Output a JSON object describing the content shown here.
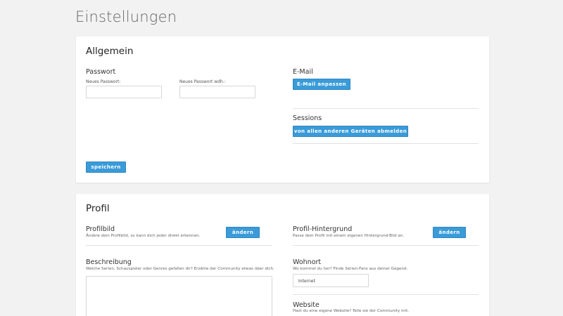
{
  "page": {
    "title": "Einstellungen"
  },
  "general": {
    "title": "Allgemein",
    "password": {
      "heading": "Passwort",
      "new_label": "Neues Passwort:",
      "repeat_label": "Neues Passwort wdh.:",
      "new_value": "",
      "repeat_value": ""
    },
    "email": {
      "heading": "E-Mail",
      "button": "E-Mail anpassen"
    },
    "sessions": {
      "heading": "Sessions",
      "button": "von allen anderen Geräten abmelden"
    },
    "save_button": "speichern"
  },
  "profile": {
    "title": "Profil",
    "picture": {
      "heading": "Profilbild",
      "description": "Ändere dein Profilbild, so kann dich jeder direkt erkennen.",
      "button": "ändern"
    },
    "background": {
      "heading": "Profil-Hintergrund",
      "description": "Passe dein Profil mit einem eigenen Hintergrund-Bild an.",
      "button": "ändern"
    },
    "bio": {
      "heading": "Beschreibung",
      "description": "Welche Serien, Schauspieler oder Genres gefallen dir? Erzähle der Community etwas über dich.",
      "value": ""
    },
    "location": {
      "heading": "Wohnort",
      "description": "Wo kommst du her? Finde Serien-Fans aus deiner Gegend.",
      "value": "Internet"
    },
    "website": {
      "heading": "Website",
      "description": "Hast du eine eigene Website? Teile sie der Community mit."
    }
  },
  "colors": {
    "accent": "#3a9bd9",
    "background": "#f2f2f2",
    "card": "#ffffff"
  }
}
